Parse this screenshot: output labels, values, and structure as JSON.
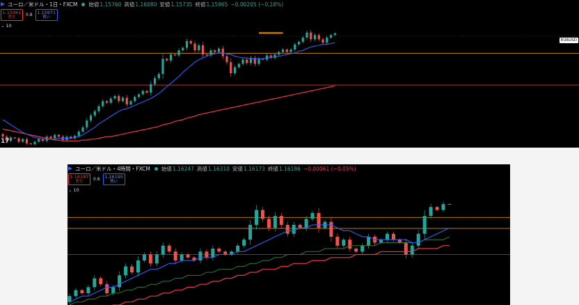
{
  "panels": [
    {
      "title": "ユーロ／米ドル・1日・FXCM",
      "ohlc": [
        {
          "k": "始値",
          "v": "1.15760"
        },
        {
          "k": "高値",
          "v": "1.16080"
        },
        {
          "k": "安値",
          "v": "1.15735"
        },
        {
          "k": "終値",
          "v": "1.15965"
        }
      ],
      "change": "−0.00205 (−0.18%)",
      "change_sign": "neg",
      "sell": {
        "price": "1.15961",
        "label": "売り"
      },
      "spread": "0.8",
      "buy": {
        "price": "1.15971",
        "label": "買い"
      },
      "indicator": "⌄ 10",
      "axis_label": "EURUSD",
      "watermark": "17"
    },
    {
      "title": "ユーロ／米ドル・4時間・FXCM",
      "ohlc": [
        {
          "k": "始値",
          "v": "1.16247"
        },
        {
          "k": "高値",
          "v": "1.16310"
        },
        {
          "k": "安値",
          "v": "1.16173"
        },
        {
          "k": "終値",
          "v": "1.16186"
        }
      ],
      "change": "−0.00061 (−0.05%)",
      "change_sign": "neg",
      "sell": {
        "price": "1.16187",
        "label": "売り"
      },
      "spread": "0.8",
      "buy": {
        "price": "1.16195",
        "label": "買い"
      },
      "indicator": "⌄ 10"
    }
  ],
  "chart_data": [
    {
      "type": "candlestick",
      "symbol": "EURUSD",
      "interval": "1日",
      "ylim": [
        1.025,
        1.183
      ],
      "grid": false,
      "colors": {
        "up": "#26a69a",
        "down": "#ef5350",
        "ma_short": "#2962ff",
        "ma_long": "#f23645",
        "hline": "#f7a600",
        "hline_red": "#d32f2f",
        "highlight": "#ff8c00"
      },
      "hlines": [
        1.1365,
        1.099
      ],
      "hlines_red": [
        1.099
      ],
      "highlight_segment": {
        "x": [
          64,
          70
        ],
        "y": 1.1605
      },
      "candles_o": [
        1.041,
        1.038,
        1.033,
        1.037,
        1.036,
        1.032,
        1.035,
        1.03,
        1.029,
        1.032,
        1.035,
        1.033,
        1.038,
        1.036,
        1.04,
        1.038,
        1.034,
        1.038,
        1.036,
        1.039,
        1.044,
        1.049,
        1.057,
        1.063,
        1.068,
        1.074,
        1.08,
        1.078,
        1.083,
        1.086,
        1.08,
        1.084,
        1.076,
        1.08,
        1.085,
        1.088,
        1.092,
        1.09,
        1.1,
        1.107,
        1.112,
        1.13,
        1.128,
        1.135,
        1.134,
        1.14,
        1.143,
        1.151,
        1.148,
        1.14,
        1.146,
        1.135,
        1.134,
        1.14,
        1.138,
        1.142,
        1.133,
        1.126,
        1.113,
        1.12,
        1.124,
        1.129,
        1.125,
        1.131,
        1.124,
        1.13,
        1.129,
        1.134,
        1.131,
        1.135,
        1.138,
        1.141,
        1.138,
        1.141,
        1.147,
        1.15,
        1.155,
        1.161,
        1.153,
        1.158,
        1.153,
        1.149,
        1.155,
        1.158
      ],
      "candles_c": [
        1.038,
        1.033,
        1.037,
        1.036,
        1.032,
        1.035,
        1.03,
        1.029,
        1.032,
        1.035,
        1.033,
        1.038,
        1.036,
        1.04,
        1.038,
        1.034,
        1.038,
        1.036,
        1.039,
        1.044,
        1.049,
        1.057,
        1.063,
        1.068,
        1.074,
        1.08,
        1.078,
        1.083,
        1.086,
        1.08,
        1.084,
        1.076,
        1.08,
        1.085,
        1.088,
        1.092,
        1.09,
        1.1,
        1.107,
        1.112,
        1.13,
        1.128,
        1.135,
        1.134,
        1.14,
        1.143,
        1.151,
        1.148,
        1.14,
        1.146,
        1.135,
        1.134,
        1.14,
        1.138,
        1.142,
        1.133,
        1.126,
        1.113,
        1.12,
        1.124,
        1.129,
        1.125,
        1.131,
        1.124,
        1.13,
        1.129,
        1.134,
        1.131,
        1.135,
        1.138,
        1.141,
        1.138,
        1.141,
        1.147,
        1.15,
        1.155,
        1.161,
        1.153,
        1.158,
        1.153,
        1.149,
        1.155,
        1.158,
        1.16
      ],
      "ma_short": [
        1.058,
        1.055,
        1.052,
        1.049,
        1.046,
        1.043,
        1.041,
        1.039,
        1.037,
        1.036,
        1.035,
        1.035,
        1.035,
        1.035,
        1.036,
        1.036,
        1.036,
        1.036,
        1.037,
        1.038,
        1.04,
        1.043,
        1.046,
        1.049,
        1.053,
        1.056,
        1.059,
        1.062,
        1.065,
        1.068,
        1.07,
        1.071,
        1.073,
        1.075,
        1.077,
        1.079,
        1.081,
        1.083,
        1.086,
        1.089,
        1.093,
        1.097,
        1.101,
        1.105,
        1.109,
        1.114,
        1.118,
        1.122,
        1.126,
        1.129,
        1.131,
        1.133,
        1.135,
        1.136,
        1.137,
        1.137,
        1.136,
        1.135,
        1.133,
        1.132,
        1.131,
        1.131,
        1.13,
        1.13,
        1.13,
        1.13,
        1.131,
        1.132,
        1.132,
        1.133,
        1.134,
        1.135,
        1.136,
        1.137,
        1.139,
        1.14,
        1.142,
        1.144,
        1.145,
        1.146,
        1.147,
        1.147,
        1.148,
        1.149
      ],
      "ma_long": [
        1.047,
        1.046,
        1.045,
        1.044,
        1.043,
        1.042,
        1.041,
        1.04,
        1.039,
        1.038,
        1.037,
        1.036,
        1.035,
        1.034,
        1.034,
        1.033,
        1.033,
        1.033,
        1.033,
        1.033,
        1.034,
        1.034,
        1.035,
        1.035,
        1.036,
        1.037,
        1.038,
        1.038,
        1.039,
        1.04,
        1.041,
        1.042,
        1.043,
        1.044,
        1.045,
        1.046,
        1.047,
        1.048,
        1.049,
        1.05,
        1.052,
        1.053,
        1.054,
        1.056,
        1.057,
        1.058,
        1.06,
        1.061,
        1.062,
        1.064,
        1.065,
        1.066,
        1.067,
        1.068,
        1.069,
        1.07,
        1.071,
        1.072,
        1.073,
        1.074,
        1.075,
        1.076,
        1.077,
        1.078,
        1.079,
        1.08,
        1.081,
        1.082,
        1.083,
        1.084,
        1.085,
        1.086,
        1.087,
        1.088,
        1.089,
        1.09,
        1.091,
        1.092,
        1.093,
        1.094,
        1.095,
        1.096,
        1.097,
        1.098
      ]
    },
    {
      "type": "candlestick",
      "symbol": "EURUSD",
      "interval": "4時間",
      "ylim": [
        1.128,
        1.166
      ],
      "grid": false,
      "colors": {
        "up": "#26a69a",
        "down": "#ef5350",
        "ma_short": "#2962ff",
        "ma_mid": "#2e7d32",
        "ma_long": "#f23645",
        "hline": "#f7a600",
        "hline_red": "#d32f2f"
      },
      "hlines": [
        1.1575,
        1.1538
      ],
      "hlines_red": [
        1.145
      ],
      "candles_o": [
        1.129,
        1.131,
        1.133,
        1.132,
        1.134,
        1.137,
        1.135,
        1.132,
        1.134,
        1.138,
        1.141,
        1.139,
        1.143,
        1.145,
        1.142,
        1.145,
        1.148,
        1.146,
        1.143,
        1.145,
        1.144,
        1.143,
        1.146,
        1.144,
        1.147,
        1.146,
        1.145,
        1.146,
        1.148,
        1.15,
        1.155,
        1.16,
        1.157,
        1.154,
        1.158,
        1.155,
        1.152,
        1.155,
        1.154,
        1.157,
        1.159,
        1.154,
        1.156,
        1.151,
        1.148,
        1.15,
        1.147,
        1.146,
        1.148,
        1.151,
        1.149,
        1.15,
        1.152,
        1.15,
        1.149,
        1.145,
        1.148,
        1.152,
        1.158,
        1.161,
        1.16,
        1.162
      ],
      "candles_c": [
        1.131,
        1.133,
        1.132,
        1.134,
        1.137,
        1.135,
        1.132,
        1.134,
        1.138,
        1.141,
        1.139,
        1.143,
        1.145,
        1.142,
        1.145,
        1.148,
        1.146,
        1.143,
        1.145,
        1.144,
        1.143,
        1.146,
        1.144,
        1.147,
        1.146,
        1.145,
        1.146,
        1.148,
        1.15,
        1.155,
        1.16,
        1.157,
        1.154,
        1.158,
        1.155,
        1.152,
        1.155,
        1.154,
        1.157,
        1.159,
        1.154,
        1.156,
        1.151,
        1.148,
        1.15,
        1.147,
        1.146,
        1.148,
        1.151,
        1.149,
        1.15,
        1.152,
        1.15,
        1.149,
        1.145,
        1.148,
        1.152,
        1.158,
        1.161,
        1.16,
        1.162,
        1.162
      ],
      "ma_short": [
        1.129,
        1.13,
        1.131,
        1.131,
        1.132,
        1.133,
        1.134,
        1.134,
        1.135,
        1.136,
        1.137,
        1.138,
        1.139,
        1.14,
        1.14,
        1.141,
        1.142,
        1.142,
        1.143,
        1.143,
        1.143,
        1.144,
        1.144,
        1.144,
        1.145,
        1.145,
        1.145,
        1.146,
        1.146,
        1.147,
        1.148,
        1.149,
        1.15,
        1.151,
        1.152,
        1.153,
        1.153,
        1.154,
        1.154,
        1.155,
        1.155,
        1.155,
        1.155,
        1.154,
        1.153,
        1.153,
        1.152,
        1.151,
        1.151,
        1.15,
        1.15,
        1.15,
        1.15,
        1.15,
        1.15,
        1.149,
        1.149,
        1.15,
        1.151,
        1.152,
        1.153,
        1.154
      ],
      "ma_mid": [
        1.128,
        1.129,
        1.129,
        1.13,
        1.13,
        1.131,
        1.131,
        1.132,
        1.132,
        1.133,
        1.133,
        1.134,
        1.134,
        1.135,
        1.135,
        1.136,
        1.136,
        1.137,
        1.137,
        1.138,
        1.138,
        1.138,
        1.139,
        1.139,
        1.14,
        1.14,
        1.14,
        1.141,
        1.141,
        1.142,
        1.142,
        1.143,
        1.143,
        1.144,
        1.144,
        1.145,
        1.145,
        1.145,
        1.146,
        1.146,
        1.146,
        1.147,
        1.147,
        1.147,
        1.147,
        1.148,
        1.148,
        1.148,
        1.148,
        1.148,
        1.149,
        1.149,
        1.149,
        1.149,
        1.149,
        1.149,
        1.149,
        1.15,
        1.15,
        1.15,
        1.15,
        1.151
      ],
      "ma_long": [
        1.124,
        1.125,
        1.125,
        1.126,
        1.126,
        1.127,
        1.127,
        1.128,
        1.128,
        1.129,
        1.129,
        1.13,
        1.13,
        1.131,
        1.131,
        1.132,
        1.132,
        1.133,
        1.133,
        1.134,
        1.134,
        1.135,
        1.135,
        1.136,
        1.136,
        1.137,
        1.137,
        1.138,
        1.138,
        1.139,
        1.139,
        1.14,
        1.14,
        1.14,
        1.141,
        1.141,
        1.142,
        1.142,
        1.142,
        1.143,
        1.143,
        1.143,
        1.144,
        1.144,
        1.144,
        1.144,
        1.145,
        1.145,
        1.145,
        1.145,
        1.146,
        1.146,
        1.146,
        1.146,
        1.146,
        1.146,
        1.147,
        1.147,
        1.147,
        1.147,
        1.148,
        1.148
      ]
    }
  ]
}
